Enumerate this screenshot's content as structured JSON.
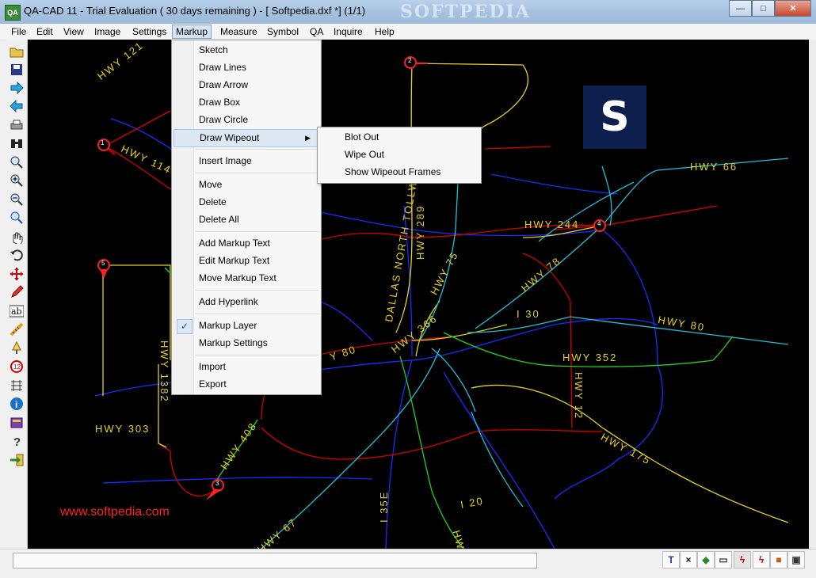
{
  "window": {
    "title": "QA-CAD 11 - Trial Evaluation ( 30 days remaining )  -  [ Softpedia.dxf *] (1/1)",
    "icon_text": "QA",
    "watermark": "SOFTPEDIA"
  },
  "menubar": {
    "items": [
      "File",
      "Edit",
      "View",
      "Image",
      "Settings",
      "Markup",
      "Measure",
      "Symbol",
      "QA",
      "Inquire",
      "Help"
    ],
    "active": "Markup"
  },
  "markup_menu": {
    "items": [
      "Sketch",
      "Draw Lines",
      "Draw Arrow",
      "Draw Box",
      "Draw Circle",
      "Draw Wipeout",
      "Insert Image",
      "Move",
      "Delete",
      "Delete All",
      "Add Markup Text",
      "Edit Markup Text",
      "Move Markup Text",
      "Add Hyperlink",
      "Markup Layer",
      "Markup Settings",
      "Import",
      "Export"
    ],
    "checked": "Markup Layer",
    "highlighted": "Draw Wipeout",
    "check_mark": "✓",
    "submenu_arrow": "▶"
  },
  "wipeout_submenu": {
    "items": [
      "Blot Out",
      "Wipe Out",
      "Show Wipeout Frames"
    ]
  },
  "map_labels": {
    "hwy121": "HWY 121",
    "hwy114": "HWY 114",
    "hwy66": "HWY 66",
    "hwy244": "HWY 244",
    "hwy78": "HWY 78",
    "hwy75": "HWY 75",
    "hwy289": "HWY 289",
    "dnt": "DALLAS NORTH TOLLWAY",
    "hwy366": "HWY 366",
    "i30": "I 30",
    "hwy80e": "HWY 80",
    "hwy80w": "HWY 80",
    "hwy352": "HWY 352",
    "hwy12": "HWY 12",
    "hwy1382": "HWY 1382",
    "hwy303": "HWY 303",
    "hwy408": "HWY 408",
    "hwy175": "HWY 175",
    "i20": "I 20",
    "i35e": "I 35E",
    "hwy67": "HWY 67",
    "hwy_partial": "HW",
    "site": "www.softpedia.com",
    "logo": "S",
    "marker1": "1",
    "marker2": "2",
    "marker4": "4",
    "marker5": "5",
    "marker3": "3"
  },
  "colors": {
    "canvas_bg": "#000000",
    "road_blue": "#1a2cff",
    "road_red": "#d40000",
    "road_yellow": "#e6d21e",
    "road_cyan": "#21c0d8",
    "road_green": "#22d022",
    "label_yellow": "#e6d21e",
    "site_red": "#ff2020"
  },
  "toolbar_icons": [
    "open-folder-icon",
    "save-icon",
    "forward-arrow-icon",
    "back-arrow-icon",
    "print-icon",
    "binoculars-icon",
    "zoom-icon",
    "zoom-in-icon",
    "zoom-out-icon",
    "zoom-window-icon",
    "pan-hand-icon",
    "undo-icon",
    "move-icon",
    "pencil-icon",
    "text-ab-icon",
    "measure-icon",
    "lamp-icon",
    "symbol-icon",
    "grid-icon",
    "info-icon",
    "book-icon",
    "help-icon",
    "exit-icon"
  ],
  "status_icons": [
    "T",
    "×",
    "◆",
    "▭",
    "ϟ",
    "ϟ",
    "■",
    "▣"
  ]
}
